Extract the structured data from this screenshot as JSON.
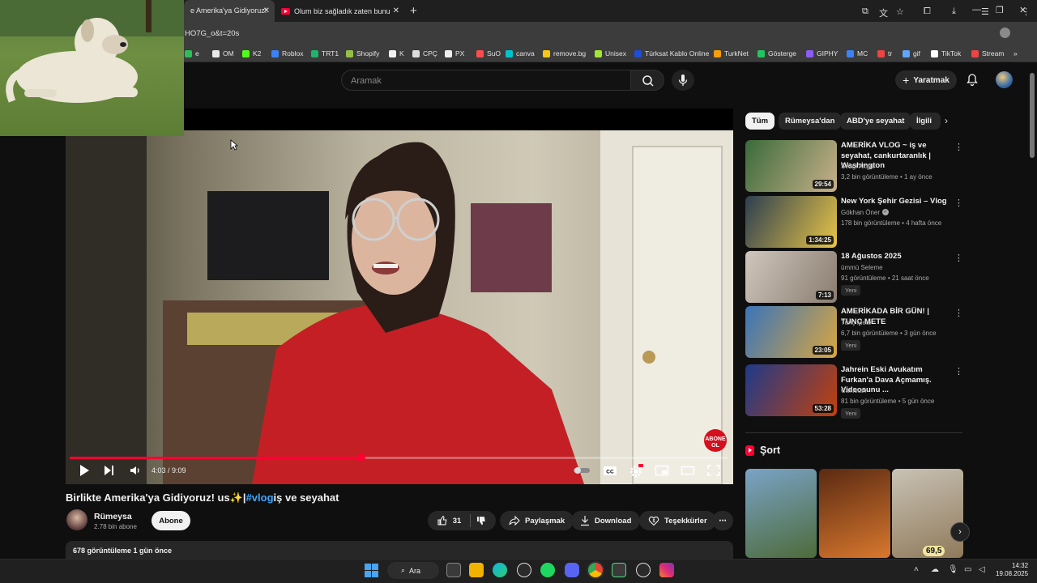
{
  "browser": {
    "tabs": [
      {
        "title": "e Amerika'ya Gidiyoruz! us ✨|#"
      },
      {
        "title": "Olum biz sağladık zaten bunu sim"
      }
    ],
    "url": "HO7G_o&t=20s",
    "bookmarks": [
      {
        "label": "e",
        "color": "#2ebd59"
      },
      {
        "label": "OM",
        "color": "#e8e8e8"
      },
      {
        "label": "K2",
        "color": "#53fc18"
      },
      {
        "label": "Roblox",
        "color": "#3b82f6"
      },
      {
        "label": "TRT1",
        "color": "#1fb36b"
      },
      {
        "label": "Shopify",
        "color": "#95bf47"
      },
      {
        "label": "K",
        "color": "#f1f1f1"
      },
      {
        "label": "CPÇ",
        "color": "#dddddd"
      },
      {
        "label": "PX",
        "color": "#eeeeee"
      },
      {
        "label": "SuO",
        "color": "#ff4d4d"
      },
      {
        "label": "canva",
        "color": "#00c4cc"
      },
      {
        "label": "remove.bg",
        "color": "#f5c518"
      },
      {
        "label": "Unisex",
        "color": "#a3e635"
      },
      {
        "label": "Türksat Kablo Online",
        "color": "#1d4ed8"
      },
      {
        "label": "TurkNet",
        "color": "#f59e0b"
      },
      {
        "label": "Gösterge",
        "color": "#22c55e"
      },
      {
        "label": "GIPHY",
        "color": "#8b5cf6"
      },
      {
        "label": "MC",
        "color": "#3b82f6"
      },
      {
        "label": "tr",
        "color": "#ef4444"
      },
      {
        "label": "gif",
        "color": "#60a5fa"
      },
      {
        "label": "TikTok",
        "color": "#ffffff"
      },
      {
        "label": "Stream",
        "color": "#ef4444"
      }
    ]
  },
  "header": {
    "search_placeholder": "Aramak",
    "create_label": "Yaratmak"
  },
  "player": {
    "time": "4:03 / 9:09",
    "progress": 0.443,
    "subscribe_badge": "ABONE OL"
  },
  "video": {
    "title_before": "Birlikte Amerika'ya Gidiyoruz! us✨|",
    "title_tag": "#vlog",
    "title_after": "iş ve seyahat",
    "channel": "Rümeysa",
    "subscribers": "2.78 bin abone",
    "subscribe": "Abone",
    "likes": "31",
    "share": "Paylaşmak",
    "download": "Download",
    "thanks": "Teşekkürler",
    "description": "678 görüntüleme 1 gün önce"
  },
  "chips": [
    "Tüm",
    "Rümeysa'dan",
    "ABD'ye seyahat",
    "İlgili"
  ],
  "related": [
    {
      "title": "AMERİKA VLOG ~ iş ve seyahat, cankurtaranlık | Washington",
      "channel": "Sezgi Akgül",
      "meta": "3,2 bin görüntüleme • 1 ay önce",
      "duration": "29:54",
      "badge": "",
      "verified": false,
      "colors": [
        "#3a6b3a",
        "#c9b08a"
      ]
    },
    {
      "title": "New York Şehir Gezisi – Vlog",
      "channel": "Gökhan Öner",
      "meta": "178 bin görüntüleme • 4 hafta önce",
      "duration": "1:34:25",
      "badge": "",
      "verified": true,
      "colors": [
        "#2c3e50",
        "#e8c547"
      ]
    },
    {
      "title": "18 Ağustos 2025",
      "channel": "ümmü Seleme",
      "meta": "91 görüntüleme • 21 saat önce",
      "duration": "7:13",
      "badge": "Yeni",
      "verified": false,
      "colors": [
        "#cfc6bd",
        "#8a7d70"
      ]
    },
    {
      "title": "AMERİKADA BİR GÜN! | TUNÇ METE",
      "channel": "Tunç Mete",
      "meta": "6,7 bin görüntüleme • 3 gün önce",
      "duration": "23:05",
      "badge": "Yeni",
      "verified": false,
      "colors": [
        "#3a74b8",
        "#d9a640"
      ]
    },
    {
      "title": "Jahrein Eski Avukatım Furkan'a Dava Açmamış. Videosunu ...",
      "channel": "Cahistan",
      "meta": "81 bin görüntüleme • 5 gün önce",
      "duration": "53:28",
      "badge": "Yeni",
      "verified": false,
      "colors": [
        "#1e3a8a",
        "#c2410c"
      ]
    }
  ],
  "shorts": {
    "heading": "Şort",
    "items": [
      {
        "colors": [
          "#7aa3c7",
          "#4d6b3a"
        ]
      },
      {
        "colors": [
          "#5a2a12",
          "#d9782e"
        ]
      },
      {
        "colors": [
          "#c9c2b5",
          "#8f7a5a"
        ],
        "label": "69,5"
      }
    ]
  },
  "taskbar": {
    "search": "Ara",
    "time": "14:32",
    "date": "19.08.2025"
  }
}
